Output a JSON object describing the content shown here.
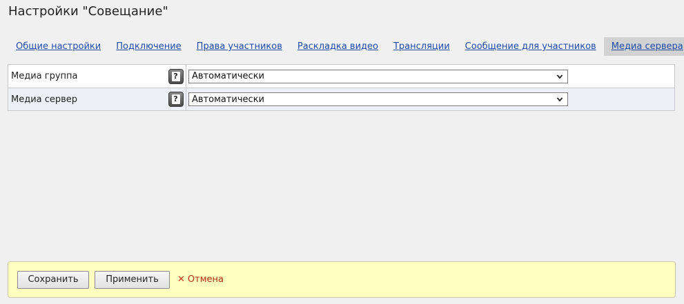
{
  "page": {
    "title": "Настройки \"Совещание\""
  },
  "tabs": [
    {
      "label": "Общие настройки",
      "active": false
    },
    {
      "label": "Подключение",
      "active": false
    },
    {
      "label": "Права участников",
      "active": false
    },
    {
      "label": "Раскладка видео",
      "active": false
    },
    {
      "label": "Трансляции",
      "active": false
    },
    {
      "label": "Сообщение для участников",
      "active": false
    },
    {
      "label": "Медиа сервера",
      "active": true
    }
  ],
  "settings": [
    {
      "label": "Медиа группа",
      "help_icon": "help-icon",
      "value": "Автоматически"
    },
    {
      "label": "Медиа сервер",
      "help_icon": "help-icon",
      "value": "Автоматически"
    }
  ],
  "footer": {
    "save_label": "Сохранить",
    "apply_label": "Применить",
    "cancel_label": "Отмена",
    "cancel_icon": "close-icon"
  },
  "colors": {
    "background": "#f0f0f0",
    "link": "#1f4aa8",
    "active_tab": "#d2d2d2",
    "footer_bg": "#ffffc0",
    "cancel": "#b03010"
  }
}
